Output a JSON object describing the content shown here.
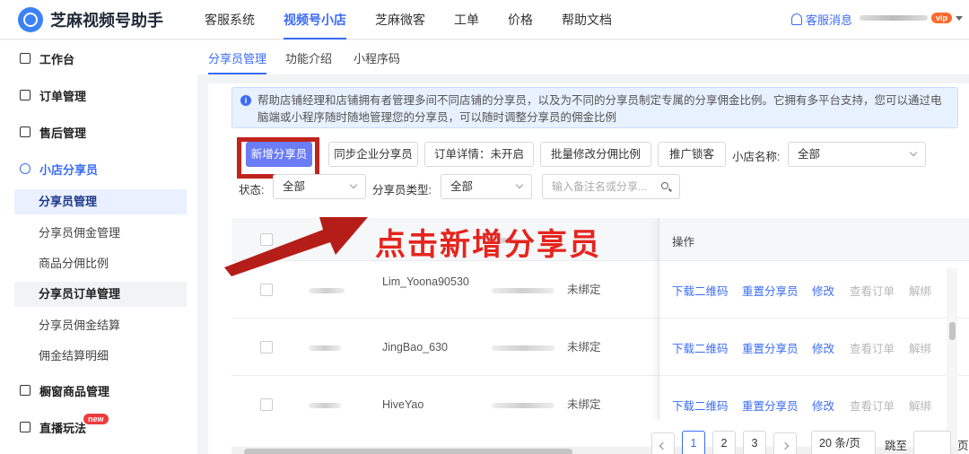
{
  "header": {
    "logo_text": "芝麻视频号助手",
    "nav": [
      "客服系统",
      "视频号小店",
      "芝麻微客",
      "工单",
      "价格",
      "帮助文档"
    ],
    "kefu_label": "客服消息",
    "vip_badge": "vip"
  },
  "sidebar": {
    "groups": {
      "workbench": "工作台",
      "orders": "订单管理",
      "aftersale": "售后管理",
      "sharer": "小店分享员",
      "window": "橱窗商品管理",
      "live": "直播玩法"
    },
    "sub_items": [
      "分享员管理",
      "分享员佣金管理",
      "商品分佣比例",
      "分享员订单管理",
      "分享员佣金结算",
      "佣金结算明细"
    ],
    "new_badge": "new"
  },
  "tabs": [
    "分享员管理",
    "功能介绍",
    "小程序码"
  ],
  "info_text": "帮助店铺经理和店铺拥有者管理多间不同店铺的分享员，以及为不同的分享员制定专属的分享佣金比例。它拥有多平台支持，您可以通过电脑端或小程序随时随地管理您的分享员，可以随时调整分享员的佣金比例",
  "info_icon": "i",
  "toolbar": {
    "add_sharer": "新增分享员",
    "sync_enterprise": "同步企业分享员",
    "order_detail": "订单详情：未开启",
    "batch_ratio": "批量修改分佣比例",
    "promote": "推广锁客",
    "shop_label": "小店名称:",
    "shop_value": "全部",
    "status_label": "状态:",
    "status_value": "全部",
    "type_label": "分享员类型:",
    "type_value": "全部",
    "search_placeholder": "输入备注名或分享..."
  },
  "table": {
    "head_op": "操作",
    "rows": [
      {
        "nickname": "Lim_Yoona90530",
        "status": "未绑定"
      },
      {
        "nickname": "JingBao_630",
        "status": "未绑定"
      },
      {
        "nickname": "HiveYao",
        "status": "未绑定"
      }
    ],
    "ops": [
      "下载二维码",
      "重置分享员",
      "修改",
      "查看订单",
      "解绑"
    ]
  },
  "pagination": {
    "pages": [
      "1",
      "2",
      "3"
    ],
    "page_size": "20 条/页",
    "jump_label": "跳至",
    "page_suffix": "页"
  },
  "annotation": "点击新增分享员",
  "colors": {
    "accent": "#3b6cf6",
    "primary_btn": "#6b7cf6",
    "annotation": "#e4251e"
  }
}
